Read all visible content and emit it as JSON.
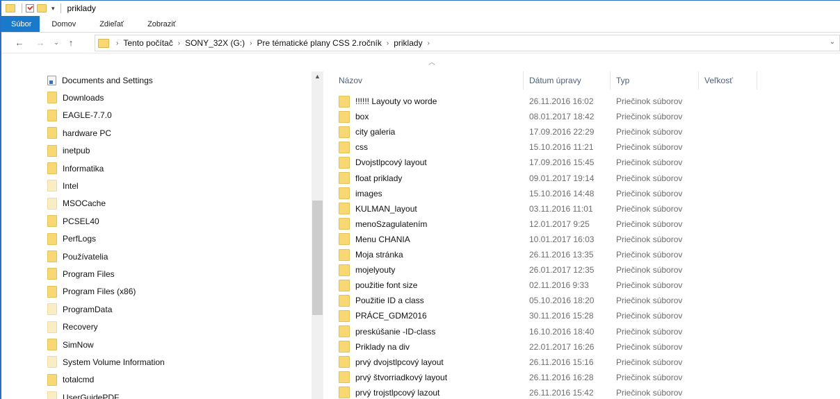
{
  "window": {
    "title": "priklady"
  },
  "ribbon": {
    "tabs": [
      "Súbor",
      "Domov",
      "Zdieľať",
      "Zobraziť"
    ]
  },
  "address": {
    "crumbs": [
      "Tento počítač",
      "SONY_32X (G:)",
      "Pre tématické plany CSS 2.ročník",
      "priklady"
    ]
  },
  "navpane": {
    "items": [
      {
        "label": "Documents and Settings",
        "icon": "shortcut-file-icon"
      },
      {
        "label": "Downloads",
        "icon": "folder-icon"
      },
      {
        "label": "EAGLE-7.7.0",
        "icon": "folder-icon"
      },
      {
        "label": "hardware PC",
        "icon": "folder-icon"
      },
      {
        "label": "inetpub",
        "icon": "folder-icon"
      },
      {
        "label": "Informatika",
        "icon": "folder-icon"
      },
      {
        "label": "Intel",
        "icon": "folder-pale-icon"
      },
      {
        "label": "MSOCache",
        "icon": "folder-pale-icon"
      },
      {
        "label": "PCSEL40",
        "icon": "folder-icon"
      },
      {
        "label": "PerfLogs",
        "icon": "folder-icon"
      },
      {
        "label": "Používatelia",
        "icon": "folder-icon"
      },
      {
        "label": "Program Files",
        "icon": "folder-icon"
      },
      {
        "label": "Program Files (x86)",
        "icon": "folder-icon"
      },
      {
        "label": "ProgramData",
        "icon": "folder-pale-icon"
      },
      {
        "label": "Recovery",
        "icon": "folder-pale-icon"
      },
      {
        "label": "SimNow",
        "icon": "folder-icon"
      },
      {
        "label": "System Volume Information",
        "icon": "folder-pale-icon"
      },
      {
        "label": "totalcmd",
        "icon": "folder-icon"
      },
      {
        "label": "UserGuidePDF",
        "icon": "folder-pale-icon"
      }
    ]
  },
  "columns": {
    "name": "Názov",
    "date": "Dátum úpravy",
    "type": "Typ",
    "size": "Veľkosť"
  },
  "files": [
    {
      "name": "!!!!!! Layouty vo worde",
      "date": "26.11.2016 16:02",
      "type": "Priečinok súborov"
    },
    {
      "name": "box",
      "date": "08.01.2017 18:42",
      "type": "Priečinok súborov"
    },
    {
      "name": "city galeria",
      "date": "17.09.2016 22:29",
      "type": "Priečinok súborov"
    },
    {
      "name": "css",
      "date": "15.10.2016 11:21",
      "type": "Priečinok súborov"
    },
    {
      "name": "Dvojstlpcový layout",
      "date": "17.09.2016 15:45",
      "type": "Priečinok súborov"
    },
    {
      "name": "float priklady",
      "date": "09.01.2017 19:14",
      "type": "Priečinok súborov"
    },
    {
      "name": "images",
      "date": "15.10.2016 14:48",
      "type": "Priečinok súborov"
    },
    {
      "name": "KULMAN_layout",
      "date": "03.11.2016 11:01",
      "type": "Priečinok súborov"
    },
    {
      "name": "menoSzagulatením",
      "date": "12.01.2017 9:25",
      "type": "Priečinok súborov"
    },
    {
      "name": "Menu CHANIA",
      "date": "10.01.2017 16:03",
      "type": "Priečinok súborov"
    },
    {
      "name": "Moja stránka",
      "date": "26.11.2016 13:35",
      "type": "Priečinok súborov"
    },
    {
      "name": "mojelyouty",
      "date": "26.01.2017 12:35",
      "type": "Priečinok súborov"
    },
    {
      "name": "použitie font size",
      "date": "02.11.2016 9:33",
      "type": "Priečinok súborov"
    },
    {
      "name": "Použitie ID a class",
      "date": "05.10.2016 18:20",
      "type": "Priečinok súborov"
    },
    {
      "name": "PRÁCE_GDM2016",
      "date": "30.11.2016 15:28",
      "type": "Priečinok súborov"
    },
    {
      "name": "preskúšanie -ID-class",
      "date": "16.10.2016 18:40",
      "type": "Priečinok súborov"
    },
    {
      "name": "Priklady na div",
      "date": "22.01.2017 16:26",
      "type": "Priečinok súborov"
    },
    {
      "name": "prvý dvojstlpcový layout",
      "date": "26.11.2016 15:16",
      "type": "Priečinok súborov"
    },
    {
      "name": "prvý štvorriadkový layout",
      "date": "26.11.2016 16:28",
      "type": "Priečinok súborov"
    },
    {
      "name": "prvý trojstlpcový lazout",
      "date": "26.11.2016 15:42",
      "type": "Priečinok súborov"
    }
  ],
  "colors": {
    "accent": "#1979ca",
    "folder": "#f8d775"
  }
}
